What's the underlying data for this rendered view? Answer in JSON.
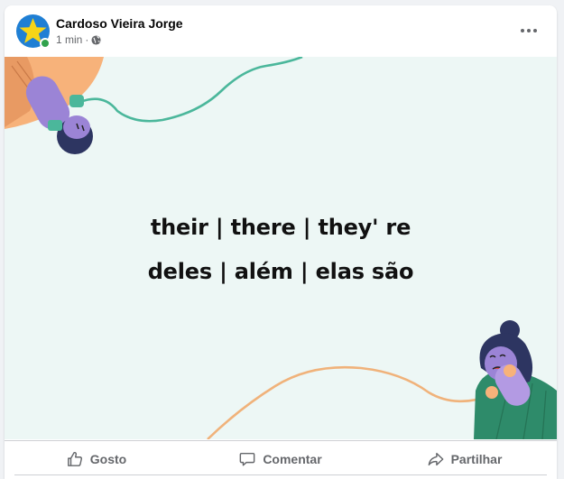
{
  "post": {
    "author": "Cardoso Vieira Jorge",
    "time": "1 min",
    "separator": "·",
    "avatar_icon": "star-icon",
    "privacy_icon": "globe-icon",
    "more_icon": "more-horizontal-icon"
  },
  "image": {
    "line1": "their | there | they' re",
    "line2": "deles | além | elas são",
    "background": "#edf7f5"
  },
  "actions": [
    {
      "label": "Gosto",
      "icon": "thumbs-up-icon"
    },
    {
      "label": "Comentar",
      "icon": "comment-icon"
    },
    {
      "label": "Partilhar",
      "icon": "share-icon"
    }
  ],
  "colors": {
    "avatar_bg": "#1f7fd4",
    "star": "#f7d417",
    "online": "#31a24c",
    "cord_green": "#4bb79b",
    "cord_orange": "#f0b27a",
    "phone_purple": "#9b84d6",
    "figure_orange": "#f7b27a",
    "figure_green": "#2e8b6a"
  }
}
